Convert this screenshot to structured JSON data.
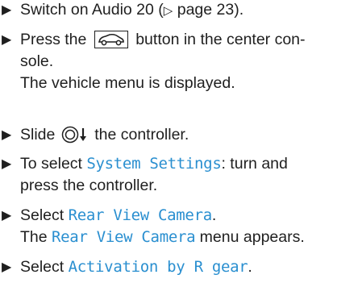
{
  "steps": [
    {
      "bullet": "▶",
      "text1": "Switch on Audio 20 (",
      "pageref": "▷",
      "text2": " page 23)."
    },
    {
      "bullet": "▶",
      "text1": "Press the ",
      "icon": "car-button-icon",
      "text2": " button in the center con-",
      "text3": "sole.",
      "result": "The vehicle menu is displayed."
    },
    {
      "bullet": "▶",
      "text1": "Slide ",
      "icon": "controller-slide-down-icon",
      "text2": " the controller."
    },
    {
      "bullet": "▶",
      "text1": "To select ",
      "hl": "System Settings",
      "text2": ": turn and",
      "text3": "press the controller."
    },
    {
      "bullet": "▶",
      "text1": "Select ",
      "hl": "Rear View Camera",
      "text2": ".",
      "result_pre": "The ",
      "result_hl": "Rear View Camera",
      "result_post": " menu appears."
    },
    {
      "bullet": "▶",
      "text1": "Select ",
      "hl": "Activation by R gear",
      "text2": "."
    }
  ],
  "colors": {
    "highlight": "#2a8fd0",
    "text": "#1f1f1f"
  }
}
